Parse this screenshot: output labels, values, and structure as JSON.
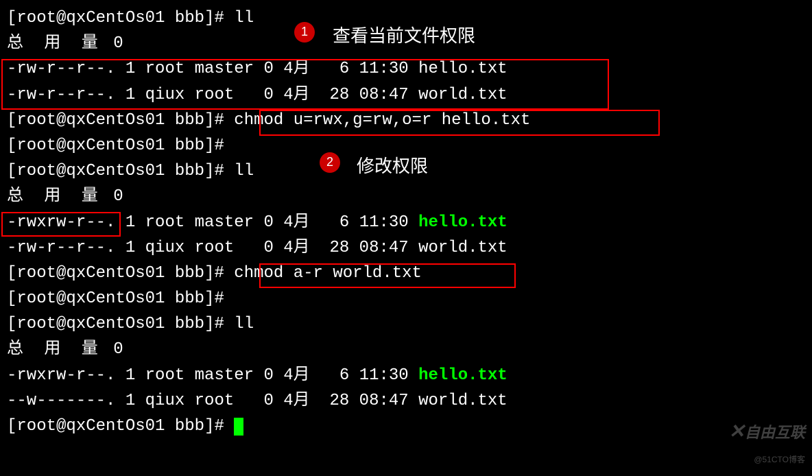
{
  "prompt": {
    "user": "root",
    "host": "qxCentOs01",
    "dir": "bbb",
    "symbol": "#"
  },
  "commands": {
    "ll": "ll",
    "chmod1": "chmod u=rwx,g=rw,o=r hello.txt",
    "chmod2": "chmod a-r world.txt"
  },
  "annotations": {
    "badge1": "1",
    "badge2": "2",
    "text1": "查看当前文件权限",
    "text2": "修改权限"
  },
  "total_label": "总 用 量",
  "total_value": "0",
  "listing1": {
    "hello": "-rw-r--r--. 1 root master 0 4月   6 11:30 hello.txt",
    "world": "-rw-r--r--. 1 qiux root   0 4月  28 08:47 world.txt"
  },
  "listing2": {
    "hello_perms": "-rwxrw-r--.",
    "hello_rest": " 1 root master 0 4月   6 11:30 ",
    "hello_name": "hello.txt",
    "world": "-rw-r--r--. 1 qiux root   0 4月  28 08:47 world.txt"
  },
  "listing3": {
    "hello_perms": "-rwxrw-r--.",
    "hello_rest": " 1 root master 0 4月   6 11:30 ",
    "hello_name": "hello.txt",
    "world": "--w-------. 1 qiux root   0 4月  28 08:47 world.txt"
  },
  "watermark": {
    "main": "自由互联",
    "sub": "@51CTO博客"
  }
}
